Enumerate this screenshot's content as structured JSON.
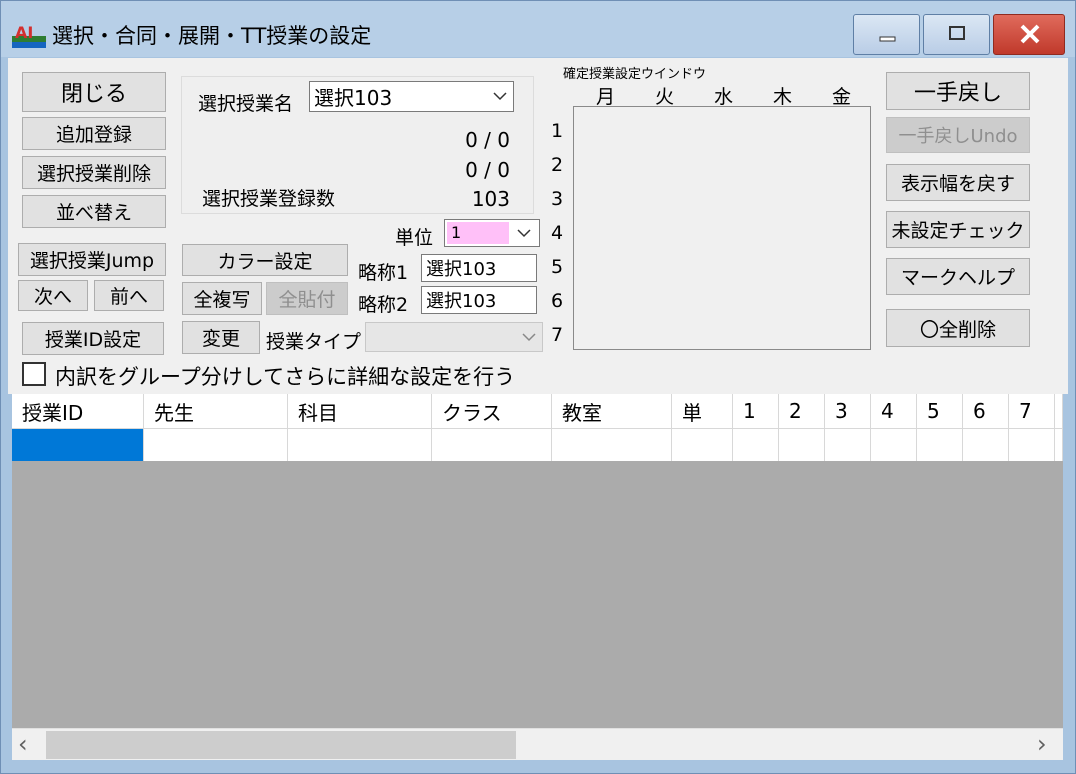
{
  "window": {
    "title": "選択・合同・展開・TT授業の設定",
    "icon_text": "AI",
    "accent_selection": "#0078d7",
    "highlight_pink": "#ffc0f8"
  },
  "left_buttons": {
    "close": "閉じる",
    "add_register": "追加登録",
    "delete_selected": "選択授業削除",
    "sort": "並べ替え",
    "jump": "選択授業Jump",
    "next": "次へ",
    "prev": "前へ",
    "lesson_id_setting": "授業ID設定"
  },
  "selection_group": {
    "name_label": "選択授業名",
    "name_value": "選択103",
    "count1": "0 / 0",
    "count2": "0 / 0",
    "registered_label": "選択授業登録数",
    "registered_value": "103"
  },
  "middle": {
    "color_setting": "カラー設定",
    "copy_all": "全複写",
    "paste_all": "全貼付",
    "change": "変更",
    "unit_label": "単位",
    "unit_value": "1",
    "abbr1_label": "略称1",
    "abbr1_value": "選択103",
    "abbr2_label": "略称2",
    "abbr2_value": "選択103",
    "type_label": "授業タイプ",
    "type_value": ""
  },
  "schedule": {
    "caption": "確定授業設定ウインドウ",
    "days": [
      "月",
      "火",
      "水",
      "木",
      "金"
    ],
    "periods": [
      "1",
      "2",
      "3",
      "4",
      "5",
      "6",
      "7"
    ]
  },
  "right_buttons": {
    "undo": "一手戻し",
    "undo_undo": "一手戻しUndo",
    "reset_width": "表示幅を戻す",
    "unset_check": "未設定チェック",
    "mark_help": "マークヘルプ",
    "delete_all": "〇全削除"
  },
  "detail_checkbox": {
    "label": "内訳をグループ分けしてさらに詳細な設定を行う",
    "checked": false
  },
  "table": {
    "headers": [
      "授業ID",
      "先生",
      "科目",
      "クラス",
      "教室",
      "単",
      "1",
      "2",
      "3",
      "4",
      "5",
      "6",
      "7"
    ]
  },
  "scrollbar": {
    "left": "‹",
    "right": "›"
  }
}
